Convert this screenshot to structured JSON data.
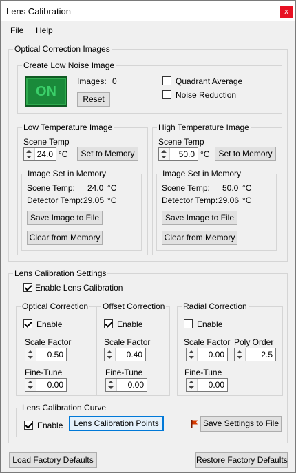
{
  "window": {
    "title": "Lens Calibration",
    "close": "x"
  },
  "menu": {
    "file": "File",
    "help": "Help"
  },
  "optical_images": {
    "legend": "Optical Correction Images",
    "low_noise": {
      "legend": "Create Low Noise Image",
      "indicator": "ON",
      "images_label": "Images:",
      "images_value": "0",
      "reset": "Reset",
      "quadrant_average": "Quadrant Average",
      "noise_reduction": "Noise Reduction",
      "quadrant_checked": false,
      "noise_checked": false
    },
    "low_temp": {
      "legend": "Low Temperature Image",
      "scene_temp_label": "Scene Temp",
      "scene_temp_value": "24.0",
      "unit": "°C",
      "set_to_memory": "Set to Memory",
      "memory_legend": "Image Set in Memory",
      "scene_temp_mem_label": "Scene Temp:",
      "scene_temp_mem_value": "24.0",
      "detector_temp_label": "Detector Temp:",
      "detector_temp_value": "29.05",
      "unit_c": "°C",
      "save_image": "Save Image to File",
      "clear_memory": "Clear from Memory"
    },
    "high_temp": {
      "legend": "High Temperature Image",
      "scene_temp_label": "Scene Temp",
      "scene_temp_value": "50.0",
      "unit": "°C",
      "set_to_memory": "Set to Memory",
      "memory_legend": "Image Set in Memory",
      "scene_temp_mem_label": "Scene Temp:",
      "scene_temp_mem_value": "50.0",
      "detector_temp_label": "Detector Temp:",
      "detector_temp_value": "29.06",
      "unit_c": "°C",
      "save_image": "Save Image to File",
      "clear_memory": "Clear from Memory"
    }
  },
  "settings": {
    "legend": "Lens Calibration Settings",
    "enable_lens_calibration": "Enable Lens Calibration",
    "enable_checked": true,
    "optical": {
      "legend": "Optical Correction",
      "enable": "Enable",
      "enable_checked": true,
      "scale_factor_label": "Scale Factor",
      "scale_factor_value": "0.50",
      "fine_tune_label": "Fine-Tune",
      "fine_tune_value": "0.00"
    },
    "offset": {
      "legend": "Offset Correction",
      "enable": "Enable",
      "enable_checked": true,
      "scale_factor_label": "Scale Factor",
      "scale_factor_value": "0.40",
      "fine_tune_label": "Fine-Tune",
      "fine_tune_value": "0.00"
    },
    "radial": {
      "legend": "Radial Correction",
      "enable": "Enable",
      "enable_checked": false,
      "scale_factor_label": "Scale Factor",
      "scale_factor_value": "0.00",
      "poly_order_label": "Poly Order",
      "poly_order_value": "2.5",
      "fine_tune_label": "Fine-Tune",
      "fine_tune_value": "0.00"
    },
    "curve": {
      "legend": "Lens Calibration Curve",
      "enable": "Enable",
      "enable_checked": true,
      "points_button": "Lens Calibration Points"
    },
    "save_settings": "Save Settings to File"
  },
  "footer": {
    "load_defaults": "Load Factory Defaults",
    "restore_defaults": "Restore Factory Defaults"
  },
  "colors": {
    "close_bg": "#e81123",
    "indicator_bg": "#1a8a3a",
    "focus_border": "#0078d7",
    "flag": "#d83b01"
  }
}
